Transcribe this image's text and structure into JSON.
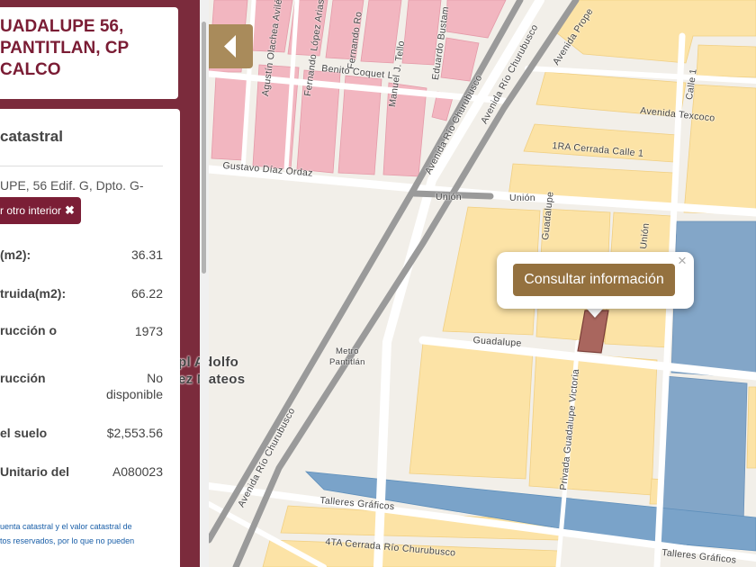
{
  "panel": {
    "address_title": "UADALUPE 56,\nPANTITLAN, CP\nCALCO",
    "details_heading": "catastral",
    "details_address": "UPE, 56 Edif. G, Dpto. G-",
    "other_interior_label": "r otro interior",
    "other_interior_icon": "close-x-icon",
    "rows": [
      {
        "label": "(m2):",
        "value": "36.31"
      },
      {
        "label": "truida(m2):",
        "value": "66.22"
      },
      {
        "label": "rucción o",
        "value": "1973"
      },
      {
        "label": "rucción",
        "value": "No\ndisponible"
      },
      {
        "label": "el suelo",
        "value": "$2,553.56"
      },
      {
        "label": "Unitario del",
        "value": "A080023"
      }
    ],
    "footnote_lines": [
      "uenta catastral y el valor catastral de",
      "tos reservados, por lo que no pueden"
    ]
  },
  "map": {
    "colors": {
      "residential_pink": "#f2b6c0",
      "commercial_yellow": "#fce3a6",
      "industrial_blue": "#83a6c8",
      "canal_blue": "#7aa3c9",
      "road_white": "#ffffff",
      "railway_gray": "#9a9a9a",
      "selected_parcel": "#a9665e",
      "background": "#f2efe9"
    },
    "street_labels": [
      "Agustín Olachea Avilés",
      "Fernando López Arias",
      "Fernando Ro",
      "Benito Coquet L",
      "Manuel J. Tello",
      "Eduardo Bustam",
      "Gustavo Díaz Ordaz",
      "Avenida Río Churubusco",
      "Avenida Río Churubusco",
      "Avenida Prope",
      "Unión",
      "Unión",
      "Calle 1",
      "Avenida Texcoco",
      "1RA Cerrada Calle 1",
      "Privada Guadalupe Victoria",
      "Guadalupe",
      "Unión",
      "Metro\nPantitlán",
      "Avenida Río Churubusco",
      "Talleres Gráficos",
      "4TA Cerrada Río Churubusco",
      "Talleres Gráficos",
      "Guadalupe"
    ],
    "district_label": "pl Adolfo\nez Mateos"
  },
  "popup": {
    "button_label": "Consultar información",
    "close_label": "×"
  },
  "controls": {
    "collapse_icon": "chevron-left-icon"
  }
}
